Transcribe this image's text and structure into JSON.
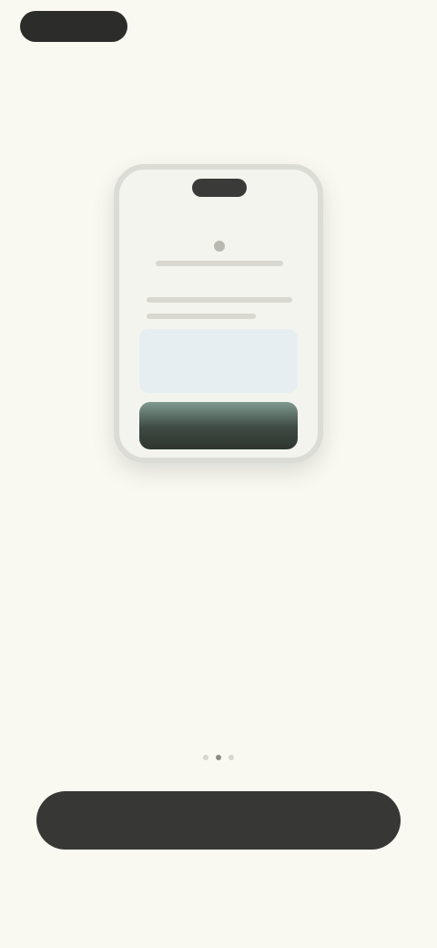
{
  "status": {
    "right_text": ""
  },
  "header": {
    "title": ""
  },
  "hero": {
    "headline": "",
    "subtext": ""
  },
  "pager": {
    "count": 3,
    "active_index": 1
  },
  "cta": {
    "label": ""
  },
  "footer": {
    "text": ""
  },
  "colors": {
    "background": "#f9f9f2",
    "cta_bg": "#373735",
    "text_primary": "#3a3a37",
    "text_muted": "#9a9a95"
  }
}
